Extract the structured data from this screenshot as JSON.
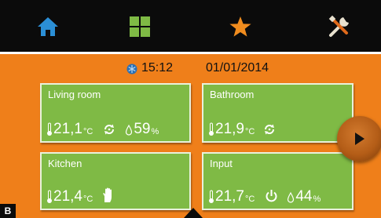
{
  "nav": {
    "items": [
      {
        "icon": "home-icon",
        "color": "#2b8fd6"
      },
      {
        "icon": "grid-icon",
        "color": "#7fba45"
      },
      {
        "icon": "star-icon",
        "color": "#f08c1e"
      },
      {
        "icon": "tools-icon",
        "color": "#e8e1cf"
      }
    ]
  },
  "status": {
    "time": "15:12",
    "date": "01/01/2014"
  },
  "rooms": [
    {
      "name": "Living room",
      "temperature": "21,1",
      "unit": "°C",
      "humidity": "59",
      "humidity_unit": "%"
    },
    {
      "name": "Bathroom",
      "temperature": "21,9",
      "unit": "°C"
    },
    {
      "name": "Kitchen",
      "temperature": "21,4",
      "unit": "°C"
    },
    {
      "name": "Input",
      "temperature": "21,7",
      "unit": "°C",
      "humidity": "44",
      "humidity_unit": "%"
    }
  ],
  "corner_badge": "B",
  "colors": {
    "background": "#ef7f1a",
    "tile": "#7fba45",
    "topbar": "#0b0b0b"
  }
}
